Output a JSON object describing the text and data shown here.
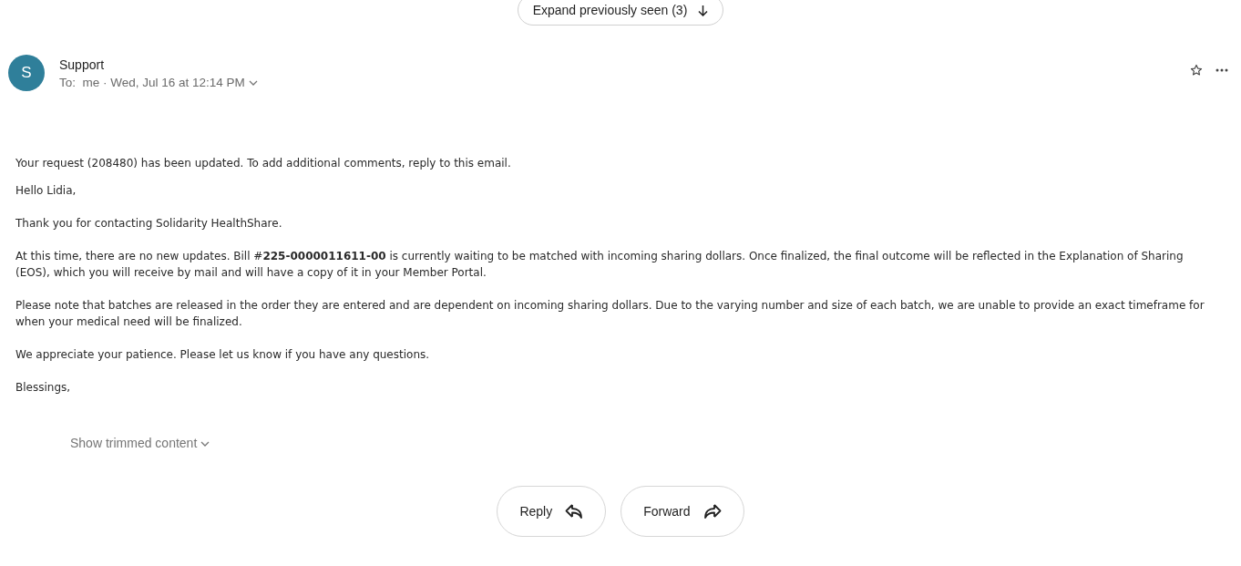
{
  "expand_button": {
    "label": "Expand previously seen (3)"
  },
  "message": {
    "avatar": "S",
    "sender": "Support",
    "recipients": "To:  me · Wed, Jul 16 at 12:14 PM",
    "starred": false,
    "body": [
      {
        "kind": "notice",
        "text": "Your request (208480) has been updated. To add additional comments, reply to this email."
      },
      {
        "kind": "paragraph",
        "text": "Hello Lidia,"
      },
      {
        "kind": "paragraph",
        "text": "Thank you for contacting Solidarity HealthShare."
      },
      {
        "kind": "paragraph",
        "text": "At this time, there are no new updates. Bill #**225-0000011611-00** is currently waiting to be matched with incoming sharing dollars. Once finalized, the final outcome will be reflected in the Explanation of Sharing (EOS), which you will receive by mail and will have a copy of it in your Member Portal."
      },
      {
        "kind": "paragraph",
        "text": "Please note that batches are released in the order they are entered and are dependent on incoming sharing dollars. Due to the varying number and size of each batch, we are unable to provide an exact timeframe for when your medical need will be finalized."
      },
      {
        "kind": "paragraph",
        "text": "We appreciate your patience. Please let us know if you have any questions."
      },
      {
        "kind": "paragraph",
        "text": "Blessings,"
      }
    ],
    "trimmed_link": "Show trimmed content"
  },
  "actions": [
    {
      "kind": "reply",
      "label": "Reply"
    },
    {
      "kind": "forward",
      "label": "Forward"
    }
  ]
}
